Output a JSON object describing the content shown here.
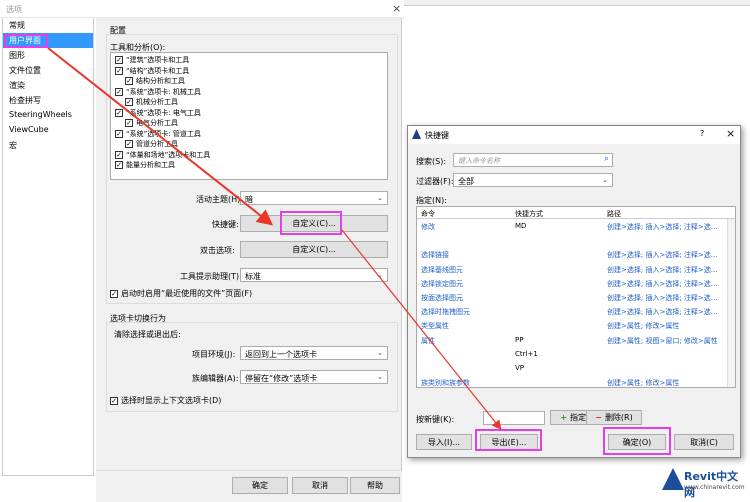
{
  "main": {
    "title": "选项",
    "nav": [
      "常规",
      "用户界面",
      "图形",
      "文件位置",
      "渲染",
      "检查拼写",
      "SteeringWheels",
      "ViewCube",
      "宏"
    ],
    "section_config": "配置",
    "tools_label": "工具和分析(O):",
    "tools": [
      {
        "label": "“建筑”选项卡和工具",
        "indent": 0
      },
      {
        "label": "“结构”选项卡和工具",
        "indent": 0
      },
      {
        "label": "结构分析和工具",
        "indent": 1
      },
      {
        "label": "“系统”选项卡: 机械工具",
        "indent": 0
      },
      {
        "label": "机械分析工具",
        "indent": 1
      },
      {
        "label": "“系统”选项卡: 电气工具",
        "indent": 0
      },
      {
        "label": "电气分析工具",
        "indent": 1
      },
      {
        "label": "“系统”选项卡: 管道工具",
        "indent": 0
      },
      {
        "label": "管道分析工具",
        "indent": 1
      },
      {
        "label": "“体量和场地”选项卡和工具",
        "indent": 0
      },
      {
        "label": "能量分析和工具",
        "indent": 0
      }
    ],
    "theme_label": "活动主题(H):",
    "theme_value": "暗",
    "shortcut_label": "快捷键:",
    "shortcut_btn": "自定义(C)...",
    "dblclick_label": "双击选项:",
    "dblclick_btn": "自定义(C)...",
    "tooltip_label": "工具提示助理(T):",
    "tooltip_value": "标准",
    "recent_label": "启动时启用“最近使用的文件”页面(F)",
    "tabswitch_title": "选项卡切换行为",
    "clear_label": "清除选择或退出后:",
    "project_label": "项目环境(J):",
    "project_value": "返回到上一个选项卡",
    "family_label": "族编辑器(A):",
    "family_value": "停留在“修改”选项卡",
    "contextual_label": "选择时显示上下文选项卡(D)",
    "ok": "确定",
    "cancel": "取消",
    "help": "帮助"
  },
  "dialog": {
    "title": "快捷键",
    "help_icon": "?",
    "close_icon": "×",
    "search_label": "搜索(S):",
    "search_placeholder": "键入命令名称",
    "filter_label": "过滤器(F):",
    "filter_value": "全部",
    "assign_label": "指定(N):",
    "headers": [
      "命令",
      "快捷方式",
      "路径"
    ],
    "rows": [
      {
        "cmd": "修改",
        "key": "MD",
        "path": "创建>选择; 插入>选择; 注释>选..."
      },
      {
        "cmd": "",
        "key": "",
        "path": ""
      },
      {
        "cmd": "选择链接",
        "key": "",
        "path": "创建>选择; 插入>选择; 注释>选..."
      },
      {
        "cmd": "选择基线图元",
        "key": "",
        "path": "创建>选择; 插入>选择; 注释>选..."
      },
      {
        "cmd": "选择锁定图元",
        "key": "",
        "path": "创建>选择; 插入>选择; 注释>选..."
      },
      {
        "cmd": "按面选择图元",
        "key": "",
        "path": "创建>选择; 插入>选择; 注释>选..."
      },
      {
        "cmd": "选择时拖拽图元",
        "key": "",
        "path": "创建>选择; 插入>选择; 注释>选..."
      },
      {
        "cmd": "类型属性",
        "key": "",
        "path": "创建>属性; 修改>属性"
      },
      {
        "cmd": "属性",
        "key": "PP",
        "path": "创建>属性; 视图>窗口; 修改>属性"
      },
      {
        "cmd": "",
        "key": "Ctrl+1",
        "path": ""
      },
      {
        "cmd": "",
        "key": "VP",
        "path": ""
      },
      {
        "cmd": "族类别和族参数",
        "key": "",
        "path": "创建>属性; 修改>属性"
      }
    ],
    "newkey_label": "按新键(K):",
    "assign_btn": "指定(A)",
    "delete_btn": "删除(R)",
    "import_btn": "导入(I)...",
    "export_btn": "导出(E)...",
    "ok": "确定(O)",
    "cancel": "取消(C)"
  },
  "watermark": {
    "brand": "Revit中文网",
    "url": "www.chinarevit.com"
  }
}
